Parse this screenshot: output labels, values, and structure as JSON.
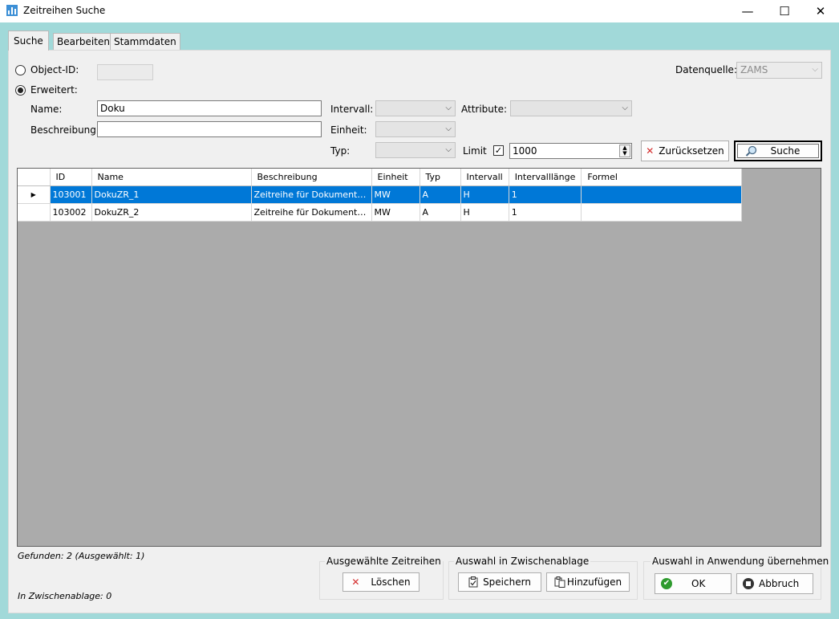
{
  "window": {
    "title": "Zeitreihen Suche",
    "minimize_glyph": "—",
    "maximize_glyph": "☐",
    "close_glyph": "✕"
  },
  "tabs": [
    {
      "label": "Suche",
      "active": true
    },
    {
      "label": "Bearbeiten",
      "active": false
    },
    {
      "label": "Stammdaten",
      "active": false
    }
  ],
  "search": {
    "object_id_label": "Object-ID:",
    "object_id_value": "",
    "erweitert_label": "Erweitert:",
    "mode": "erweitert",
    "datenquelle_label": "Datenquelle:",
    "datenquelle_value": "ZAMS",
    "name_label": "Name:",
    "name_value": "Doku",
    "beschreibung_label": "Beschreibung:",
    "beschreibung_value": "",
    "intervall_label": "Intervall:",
    "intervall_value": "",
    "einheit_label": "Einheit:",
    "einheit_value": "",
    "typ_label": "Typ:",
    "typ_value": "",
    "attribute_label": "Attribute:",
    "attribute_value": "",
    "limit_label": "Limit",
    "limit_checked": true,
    "limit_value": "1000",
    "reset_button": "Zurücksetzen",
    "search_button": "Suche"
  },
  "table": {
    "columns": [
      "ID",
      "Name",
      "Beschreibung",
      "Einheit",
      "Typ",
      "Intervall",
      "Intervalllänge",
      "Formel"
    ],
    "rows": [
      {
        "id": "103001",
        "name": "DokuZR_1",
        "beschreibung": "Zeitreihe für Dokument…",
        "einheit": "MW",
        "typ": "A",
        "intervall": "H",
        "intervalllaenge": "1",
        "formel": "",
        "selected": true
      },
      {
        "id": "103002",
        "name": "DokuZR_2",
        "beschreibung": "Zeitreihe für Dokument…",
        "einheit": "MW",
        "typ": "A",
        "intervall": "H",
        "intervalllaenge": "1",
        "formel": "",
        "selected": false
      }
    ],
    "current_row_marker": "▶"
  },
  "status": {
    "gefunden": "Gefunden: 2 (Ausgewählt: 1)",
    "zwischenablage": "In Zwischenablage: 0"
  },
  "groups": {
    "selected": {
      "title": "Ausgewählte Zeitreihen",
      "delete_button": "Löschen"
    },
    "clipboard": {
      "title": "Auswahl in Zwischenablage",
      "save_button": "Speichern",
      "add_button": "Hinzufügen"
    },
    "apply": {
      "title": "Auswahl in Anwendung übernehmen",
      "ok_button": "OK",
      "cancel_button": "Abbruch"
    }
  },
  "colors": {
    "frame": "#a1d9d9",
    "panel": "#f0f0f0",
    "selection": "#0078d7",
    "grid_background": "#ababab"
  }
}
